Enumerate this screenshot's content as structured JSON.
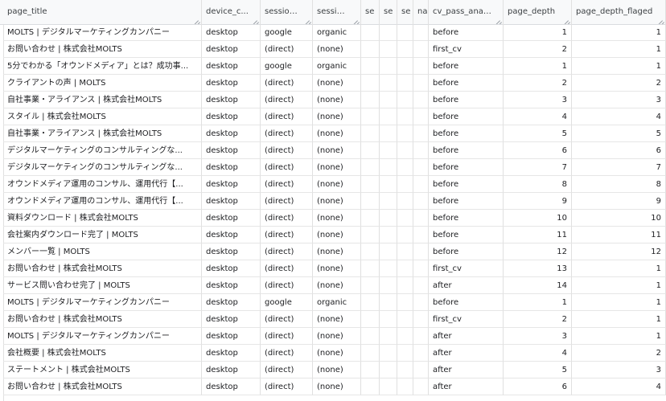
{
  "columns": [
    "page_title",
    "device_c...",
    "session...",
    "sessio...",
    "se",
    "se",
    "se",
    "na",
    "cv_pass_anal...",
    "page_depth",
    "page_depth_flaged"
  ],
  "rows": [
    [
      "MOLTS | デジタルマーケティングカンパニー",
      "desktop",
      "google",
      "organic",
      "before",
      "1",
      "1"
    ],
    [
      "お問い合わせ | 株式会社MOLTS",
      "desktop",
      "(direct)",
      "(none)",
      "first_cv",
      "2",
      "1"
    ],
    [
      "5分でわかる「オウンドメディア」とは？成功事...",
      "desktop",
      "google",
      "organic",
      "before",
      "1",
      "1"
    ],
    [
      "クライアントの声 | MOLTS",
      "desktop",
      "(direct)",
      "(none)",
      "before",
      "2",
      "2"
    ],
    [
      "自社事業・アライアンス | 株式会社MOLTS",
      "desktop",
      "(direct)",
      "(none)",
      "before",
      "3",
      "3"
    ],
    [
      "スタイル | 株式会社MOLTS",
      "desktop",
      "(direct)",
      "(none)",
      "before",
      "4",
      "4"
    ],
    [
      "自社事業・アライアンス | 株式会社MOLTS",
      "desktop",
      "(direct)",
      "(none)",
      "before",
      "5",
      "5"
    ],
    [
      "デジタルマーケティングのコンサルティングな...",
      "desktop",
      "(direct)",
      "(none)",
      "before",
      "6",
      "6"
    ],
    [
      "デジタルマーケティングのコンサルティングな...",
      "desktop",
      "(direct)",
      "(none)",
      "before",
      "7",
      "7"
    ],
    [
      "オウンドメディア運用のコンサル、運用代行【...",
      "desktop",
      "(direct)",
      "(none)",
      "before",
      "8",
      "8"
    ],
    [
      "オウンドメディア運用のコンサル、運用代行【...",
      "desktop",
      "(direct)",
      "(none)",
      "before",
      "9",
      "9"
    ],
    [
      "資料ダウンロード | 株式会社MOLTS",
      "desktop",
      "(direct)",
      "(none)",
      "before",
      "10",
      "10"
    ],
    [
      "会社案内ダウンロード完了 | MOLTS",
      "desktop",
      "(direct)",
      "(none)",
      "before",
      "11",
      "11"
    ],
    [
      "メンバー一覧 | MOLTS",
      "desktop",
      "(direct)",
      "(none)",
      "before",
      "12",
      "12"
    ],
    [
      "お問い合わせ | 株式会社MOLTS",
      "desktop",
      "(direct)",
      "(none)",
      "first_cv",
      "13",
      "1"
    ],
    [
      "サービス問い合わせ完了 | MOLTS",
      "desktop",
      "(direct)",
      "(none)",
      "after",
      "14",
      "1"
    ],
    [
      "MOLTS | デジタルマーケティングカンパニー",
      "desktop",
      "google",
      "organic",
      "before",
      "1",
      "1"
    ],
    [
      "お問い合わせ | 株式会社MOLTS",
      "desktop",
      "(direct)",
      "(none)",
      "first_cv",
      "2",
      "1"
    ],
    [
      "MOLTS | デジタルマーケティングカンパニー",
      "desktop",
      "(direct)",
      "(none)",
      "after",
      "3",
      "1"
    ],
    [
      "会社概要 | 株式会社MOLTS",
      "desktop",
      "(direct)",
      "(none)",
      "after",
      "4",
      "2"
    ],
    [
      "ステートメント | 株式会社MOLTS",
      "desktop",
      "(direct)",
      "(none)",
      "after",
      "5",
      "3"
    ],
    [
      "お問い合わせ | 株式会社MOLTS",
      "desktop",
      "(direct)",
      "(none)",
      "after",
      "6",
      "4"
    ]
  ]
}
